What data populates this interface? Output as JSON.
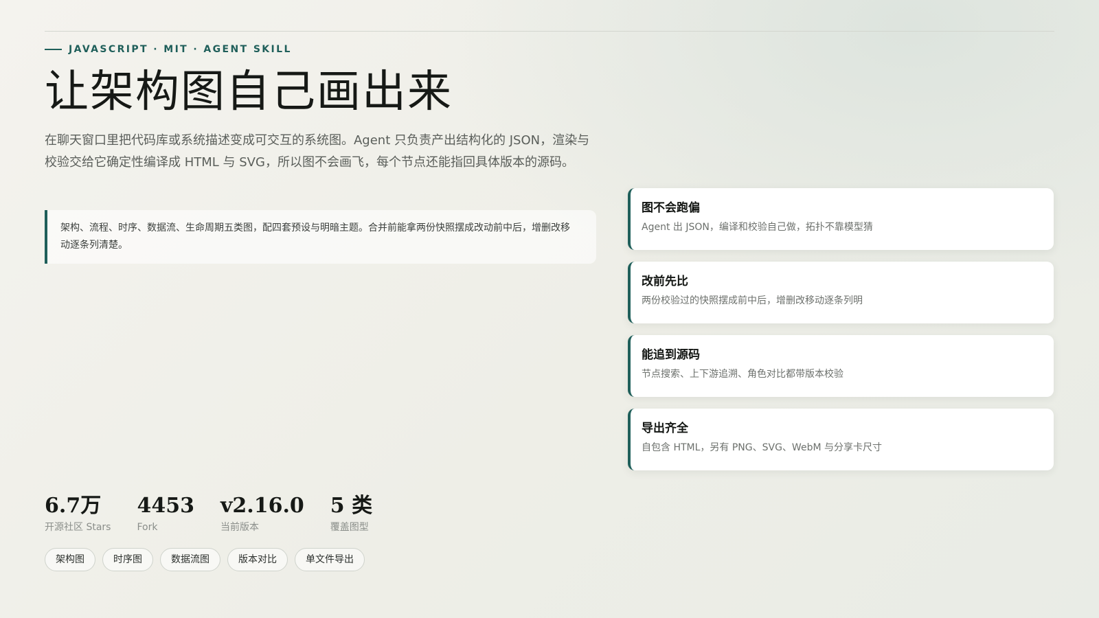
{
  "hero": {
    "eyebrow": "JAVASCRIPT · MIT · AGENT SKILL",
    "title": "让架构图自己画出来",
    "description": "在聊天窗口里把代码库或系统描述变成可交互的系统图。Agent 只负责产出结构化的 JSON，渲染与校验交给它确定性编译成 HTML 与 SVG，所以图不会画飞，每个节点还能指回具体版本的源码。",
    "quote": "架构、流程、时序、数据流、生命周期五类图，配四套预设与明暗主题。合并前能拿两份快照摆成改动前中后，增删改移动逐条列清楚。"
  },
  "features": [
    {
      "title": "图不会跑偏",
      "description": "Agent 出 JSON，编译和校验自己做，拓扑不靠模型猜"
    },
    {
      "title": "改前先比",
      "description": "两份校验过的快照摆成前中后，增删改移动逐条列明"
    },
    {
      "title": "能追到源码",
      "description": "节点搜索、上下游追溯、角色对比都带版本校验"
    },
    {
      "title": "导出齐全",
      "description": "自包含 HTML，另有 PNG、SVG、WebM 与分享卡尺寸"
    }
  ],
  "stats": [
    {
      "value": "6.7万",
      "label": "开源社区 Stars"
    },
    {
      "value": "4453",
      "label": "Fork"
    },
    {
      "value": "v2.16.0",
      "label": "当前版本"
    },
    {
      "value": "5 类",
      "label": "覆盖图型"
    }
  ],
  "tags": [
    "架构图",
    "时序图",
    "数据流图",
    "版本对比",
    "单文件导出"
  ],
  "colors": {
    "accent": "#1f5f5a",
    "background": "#f0f0ea",
    "card": "#ffffff"
  }
}
